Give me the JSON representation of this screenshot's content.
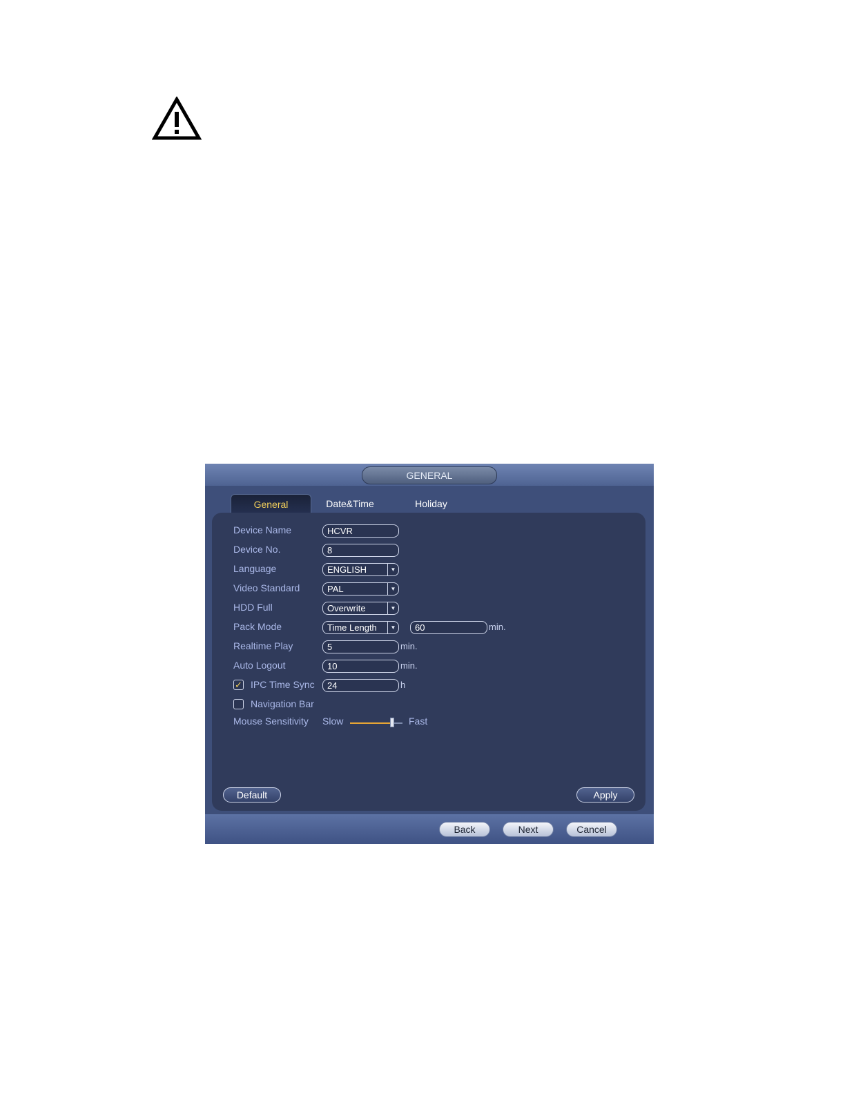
{
  "window": {
    "title": "GENERAL"
  },
  "tabs": [
    {
      "label": "General",
      "active": true
    },
    {
      "label": "Date&Time",
      "active": false
    },
    {
      "label": "Holiday",
      "active": false
    }
  ],
  "form": {
    "device_name": {
      "label": "Device Name",
      "value": "HCVR"
    },
    "device_no": {
      "label": "Device No.",
      "value": "8"
    },
    "language": {
      "label": "Language",
      "value": "ENGLISH"
    },
    "video_standard": {
      "label": "Video Standard",
      "value": "PAL"
    },
    "hdd_full": {
      "label": "HDD Full",
      "value": "Overwrite"
    },
    "pack_mode": {
      "label": "Pack Mode",
      "value": "Time Length",
      "length_value": "60",
      "unit": "min."
    },
    "realtime_play": {
      "label": "Realtime Play",
      "value": "5",
      "unit": "min."
    },
    "auto_logout": {
      "label": "Auto Logout",
      "value": "10",
      "unit": "min."
    },
    "ipc_time_sync": {
      "label": "IPC Time Sync",
      "checked": true,
      "value": "24",
      "unit": "h"
    },
    "navigation_bar": {
      "label": "Navigation Bar",
      "checked": false
    },
    "mouse_sensitivity": {
      "label": "Mouse Sensitivity",
      "slow_label": "Slow",
      "fast_label": "Fast",
      "level": 0.8
    }
  },
  "buttons": {
    "default": "Default",
    "apply": "Apply",
    "back": "Back",
    "next": "Next",
    "cancel": "Cancel"
  },
  "colors": {
    "active_tab_text": "#f2cf5b",
    "label_text": "#aab8e8",
    "slider_fill": "#e8a635"
  },
  "icons": {
    "warning": "warning-triangle-icon",
    "checkbox_checked": "checkmark-icon",
    "dropdown": "chevron-down-icon"
  }
}
